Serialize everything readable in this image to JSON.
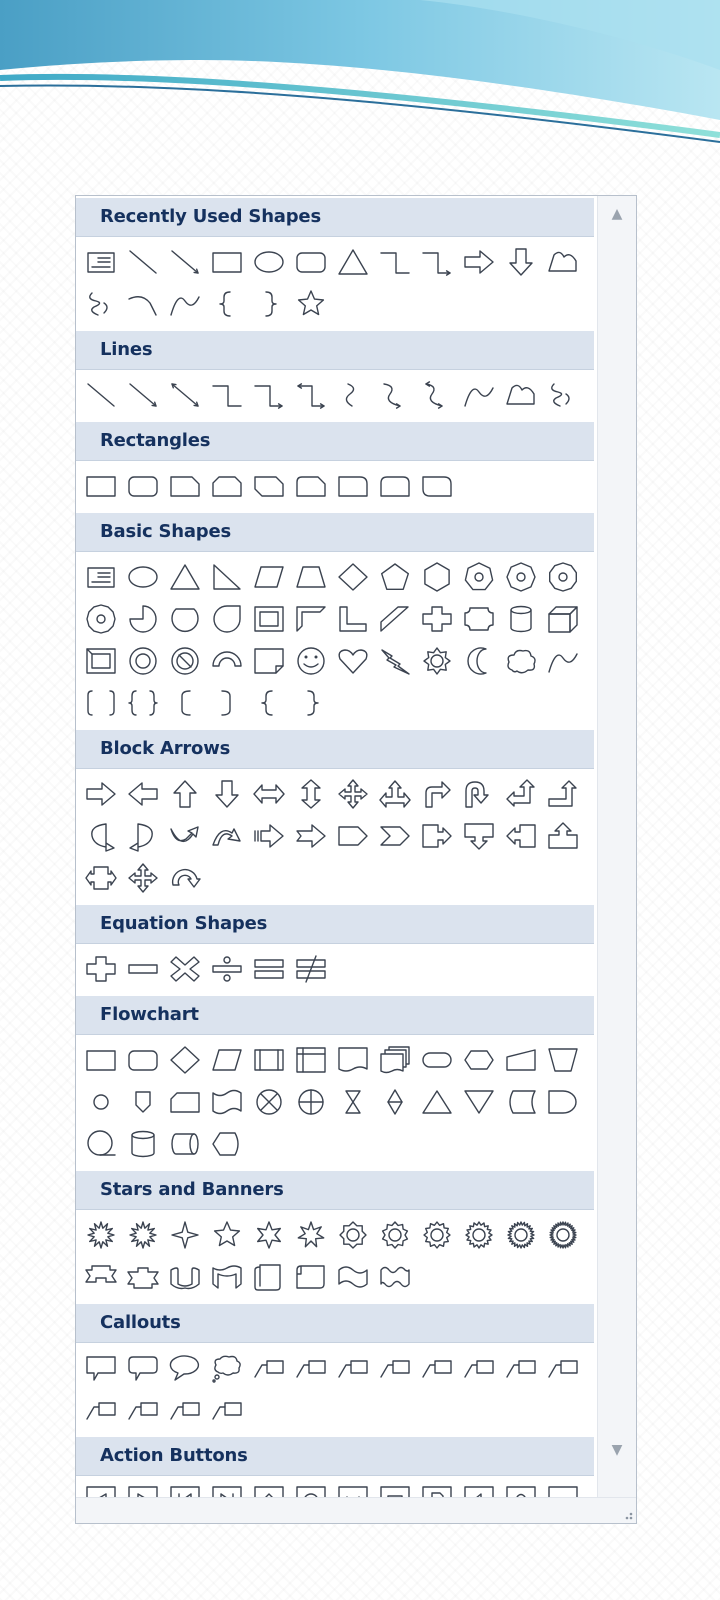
{
  "sections": [
    {
      "title": "Recently Used Shapes",
      "shapes": [
        "text-box",
        "line",
        "line-arrow",
        "rectangle",
        "oval",
        "rounded-rectangle",
        "triangle",
        "elbow-connector",
        "elbow-arrow-connector",
        "right-arrow",
        "down-arrow",
        "freeform",
        "scribble",
        "curve-connector",
        "curve",
        "left-brace",
        "right-brace",
        "star"
      ]
    },
    {
      "title": "Lines",
      "shapes": [
        "line",
        "line-arrow",
        "line-double-arrow",
        "elbow-connector",
        "elbow-arrow-connector",
        "elbow-double-arrow-connector",
        "curved-connector",
        "curved-arrow-connector",
        "curved-double-arrow-connector",
        "curve",
        "freeform",
        "scribble"
      ]
    },
    {
      "title": "Rectangles",
      "shapes": [
        "rectangle",
        "rounded-rectangle",
        "snip-single-corner",
        "snip-same-side",
        "snip-diagonal",
        "snip-round-single",
        "round-single-corner",
        "round-same-side",
        "round-diagonal"
      ]
    },
    {
      "title": "Basic Shapes",
      "shapes": [
        "text-box",
        "oval",
        "triangle",
        "right-triangle",
        "parallelogram",
        "trapezoid",
        "diamond",
        "pentagon",
        "hexagon",
        "heptagon",
        "octagon",
        "decagon",
        "dodecagon",
        "pie",
        "chord",
        "teardrop",
        "frame",
        "half-frame",
        "l-shape",
        "diagonal-stripe",
        "cross",
        "plaque",
        "can",
        "cube",
        "bevel",
        "donut",
        "no-symbol",
        "block-arc",
        "folded-corner",
        "smiley-face",
        "heart",
        "lightning-bolt",
        "sun",
        "moon",
        "cloud",
        "arc",
        "double-bracket",
        "double-brace",
        "left-bracket",
        "right-bracket",
        "left-brace",
        "right-brace"
      ]
    },
    {
      "title": "Block Arrows",
      "shapes": [
        "right-arrow",
        "left-arrow",
        "up-arrow",
        "down-arrow",
        "left-right-arrow",
        "up-down-arrow",
        "quad-arrow",
        "left-right-up-arrow",
        "bent-arrow",
        "u-turn-arrow",
        "left-up-arrow",
        "bent-up-arrow",
        "curved-right-arrow",
        "curved-left-arrow",
        "curved-up-arrow",
        "curved-down-arrow",
        "striped-right-arrow",
        "notched-right-arrow",
        "pentagon-arrow",
        "chevron",
        "right-arrow-callout",
        "down-arrow-callout",
        "left-arrow-callout",
        "up-arrow-callout",
        "left-right-arrow-callout",
        "quad-arrow-callout",
        "circular-arrow"
      ]
    },
    {
      "title": "Equation Shapes",
      "shapes": [
        "plus",
        "minus",
        "multiply",
        "division",
        "equal",
        "not-equal"
      ]
    },
    {
      "title": "Flowchart",
      "shapes": [
        "process",
        "alternate-process",
        "decision",
        "data",
        "predefined-process",
        "internal-storage",
        "document",
        "multidocument",
        "terminator",
        "preparation",
        "manual-input",
        "manual-operation",
        "connector",
        "off-page-connector",
        "card",
        "punched-tape",
        "summing-junction",
        "or",
        "collate",
        "sort",
        "extract",
        "merge",
        "stored-data",
        "delay",
        "sequential-access-storage",
        "magnetic-disk",
        "direct-access-storage",
        "display"
      ]
    },
    {
      "title": "Stars and Banners",
      "shapes": [
        "explosion-1",
        "explosion-2",
        "star-4",
        "star-5",
        "star-6",
        "star-7",
        "star-8",
        "star-10",
        "star-12",
        "star-16",
        "star-24",
        "star-32",
        "up-ribbon",
        "down-ribbon",
        "curved-up-ribbon",
        "curved-down-ribbon",
        "vertical-scroll",
        "horizontal-scroll",
        "wave",
        "double-wave"
      ]
    },
    {
      "title": "Callouts",
      "shapes": [
        "rectangular-callout",
        "rounded-rectangular-callout",
        "oval-callout",
        "cloud-callout",
        "line-callout-1",
        "line-callout-2",
        "line-callout-3",
        "line-callout-1-accent-bar",
        "line-callout-2-accent-bar",
        "line-callout-3-accent-bar",
        "line-callout-1-no-border",
        "line-callout-2-no-border",
        "line-callout-3-no-border",
        "line-callout-1-border-accent",
        "line-callout-2-border-accent",
        "line-callout-3-border-accent"
      ]
    },
    {
      "title": "Action Buttons",
      "shapes": [
        "action-back",
        "action-forward",
        "action-beginning",
        "action-end",
        "action-home",
        "action-information",
        "action-return",
        "action-movie",
        "action-document",
        "action-sound",
        "action-help",
        "action-custom"
      ]
    }
  ],
  "colors": {
    "section_header_bg": "#dbe3ee",
    "section_title": "#15315e",
    "icon_stroke": "#3b4350",
    "panel_border": "#b7c0cc"
  }
}
